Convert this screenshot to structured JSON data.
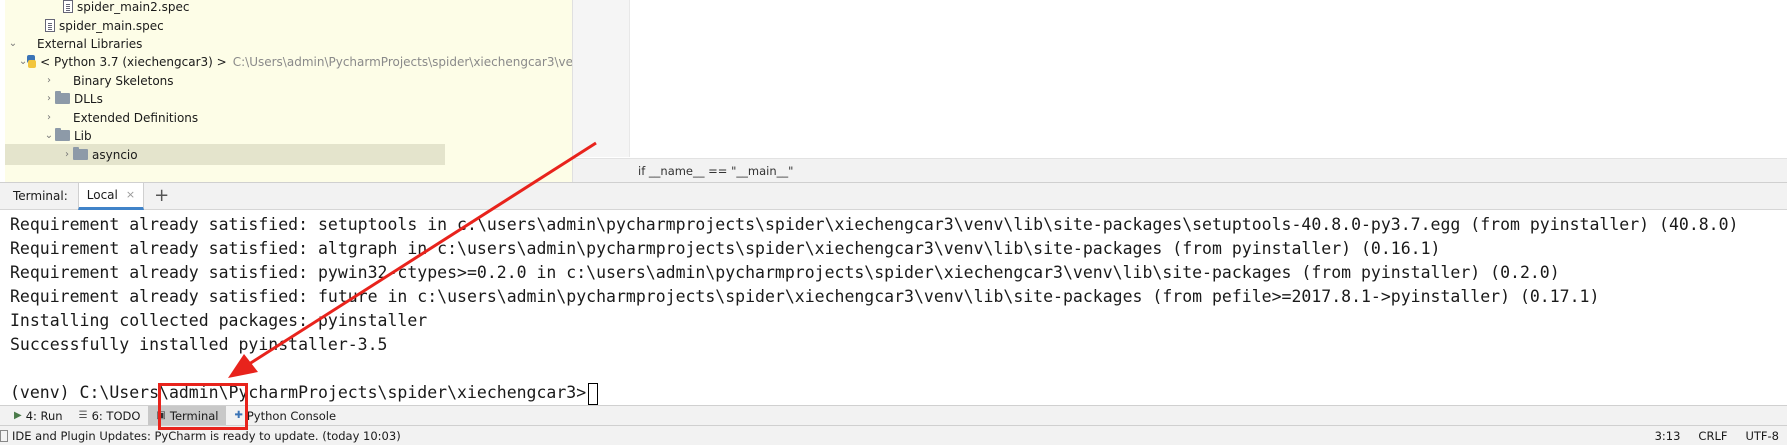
{
  "project_tree": {
    "items": [
      {
        "label": "spider_main2.spec",
        "icon": "file-icon",
        "indent": 3,
        "arrow": ""
      },
      {
        "label": "spider_main.spec",
        "icon": "file-icon",
        "indent": 2,
        "arrow": ""
      },
      {
        "label": "External Libraries",
        "icon": "library-icon",
        "indent": 0,
        "arrow": "expanded"
      },
      {
        "label": "< Python 3.7 (xiechengcar3) >",
        "path": "C:\\Users\\admin\\PycharmProjects\\spider\\xiechengcar3\\ve",
        "icon": "python-icon",
        "indent": 1,
        "arrow": "expanded"
      },
      {
        "label": "Binary Skeletons",
        "icon": "library-icon",
        "indent": 2,
        "arrow": "collapsed"
      },
      {
        "label": "DLLs",
        "icon": "folder-icon",
        "indent": 2,
        "arrow": "collapsed"
      },
      {
        "label": "Extended Definitions",
        "icon": "library-icon",
        "indent": 2,
        "arrow": "collapsed"
      },
      {
        "label": "Lib",
        "icon": "folder-icon",
        "indent": 2,
        "arrow": "expanded"
      },
      {
        "label": "asyncio",
        "icon": "folder-icon",
        "indent": 3,
        "arrow": "collapsed"
      }
    ]
  },
  "editor": {
    "breadcrumb": "if __name__ == \"__main__\""
  },
  "terminal_bar": {
    "label": "Terminal:",
    "tab_label": "Local",
    "close_glyph": "×",
    "add_glyph": "+"
  },
  "terminal": {
    "lines": [
      "Requirement already satisfied: setuptools in c:\\users\\admin\\pycharmprojects\\spider\\xiechengcar3\\venv\\lib\\site-packages\\setuptools-40.8.0-py3.7.egg (from pyinstaller) (40.8.0)",
      "Requirement already satisfied: altgraph in c:\\users\\admin\\pycharmprojects\\spider\\xiechengcar3\\venv\\lib\\site-packages (from pyinstaller) (0.16.1)",
      "Requirement already satisfied: pywin32-ctypes>=0.2.0 in c:\\users\\admin\\pycharmprojects\\spider\\xiechengcar3\\venv\\lib\\site-packages (from pyinstaller) (0.2.0)",
      "Requirement already satisfied: future in c:\\users\\admin\\pycharmprojects\\spider\\xiechengcar3\\venv\\lib\\site-packages (from pefile>=2017.8.1->pyinstaller) (0.17.1)",
      "Installing collected packages: pyinstaller",
      "Successfully installed pyinstaller-3.5",
      "",
      "(venv) C:\\Users\\admin\\PycharmProjects\\spider\\xiechengcar3>"
    ]
  },
  "tool_window_bar": {
    "buttons": [
      {
        "label": "4: Run",
        "icon": "run-icon",
        "active": false
      },
      {
        "label": "6: TODO",
        "icon": "todo-icon",
        "active": false
      },
      {
        "label": "Terminal",
        "icon": "terminal-icon",
        "active": true
      },
      {
        "label": "Python Console",
        "icon": "python-console-icon",
        "active": false
      }
    ]
  },
  "status_bar": {
    "message": "IDE and Plugin Updates: PyCharm is ready to update. (today 10:03)",
    "position": "3:13",
    "line_separator": "CRLF",
    "encoding": "UTF-8"
  },
  "annotation": {
    "color": "#e8231c"
  }
}
